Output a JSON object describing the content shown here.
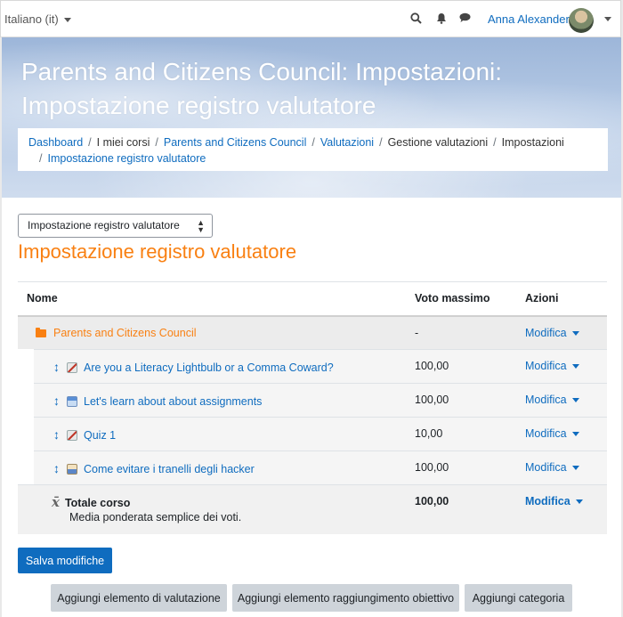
{
  "navbar": {
    "language": "Italiano (it)",
    "user_name": "Anna Alexander",
    "icons": [
      "search-icon",
      "bell-icon",
      "chat-icon"
    ]
  },
  "header": {
    "title": "Parents and Citizens Council: Impostazioni: Impostazione registro valutatore",
    "breadcrumb": [
      {
        "label": "Dashboard",
        "link": true
      },
      {
        "label": "I miei corsi",
        "link": false
      },
      {
        "label": "Parents and Citizens Council",
        "link": true
      },
      {
        "label": "Valutazioni",
        "link": true
      },
      {
        "label": "Gestione valutazioni",
        "link": false
      },
      {
        "label": "Impostazioni",
        "link": false
      },
      {
        "label": "Impostazione registro valutatore",
        "link": true
      }
    ]
  },
  "main": {
    "selector_value": "Impostazione registro valutatore",
    "heading": "Impostazione registro valutatore",
    "table": {
      "headers": {
        "name": "Nome",
        "max": "Voto massimo",
        "actions": "Azioni"
      },
      "category": {
        "name": "Parents and Citizens Council",
        "max": "-",
        "action": "Modifica"
      },
      "items": [
        {
          "name": "Are you a Literacy Lightbulb or a Comma Coward?",
          "max": "100,00",
          "action": "Modifica",
          "icon": "quiz-icon"
        },
        {
          "name": "Let's learn about about assignments",
          "max": "100,00",
          "action": "Modifica",
          "icon": "assignment-icon"
        },
        {
          "name": "Quiz 1",
          "max": "10,00",
          "action": "Modifica",
          "icon": "quiz-icon"
        },
        {
          "name": "Come evitare i tranelli degli hacker",
          "max": "100,00",
          "action": "Modifica",
          "icon": "lesson-icon"
        }
      ],
      "total": {
        "name": "Totale corso",
        "subtitle": "Media ponderata semplice dei voti.",
        "max": "100,00",
        "action": "Modifica"
      }
    },
    "buttons": {
      "save": "Salva modifiche",
      "add_grade_item": "Aggiungi elemento di valutazione",
      "add_outcome_item": "Aggiungi elemento raggiungimento obiettivo",
      "add_category": "Aggiungi categoria"
    }
  },
  "colors": {
    "brand": "#0f6cbf",
    "accent": "#f98012"
  }
}
